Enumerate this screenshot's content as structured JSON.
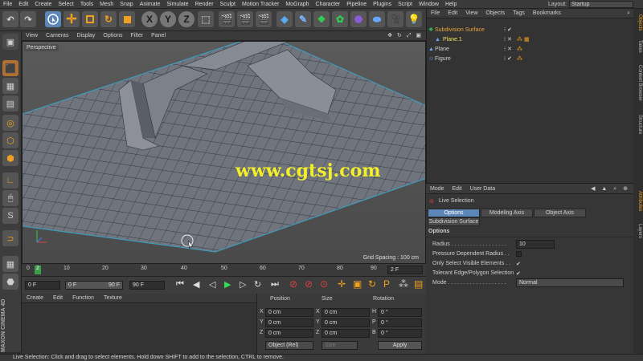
{
  "menubar": {
    "items": [
      "File",
      "Edit",
      "Create",
      "Select",
      "Tools",
      "Mesh",
      "Snap",
      "Animate",
      "Simulate",
      "Render",
      "Sculpt",
      "Motion Tracker",
      "MoGraph",
      "Character",
      "Pipeline",
      "Plugins",
      "Script",
      "Window",
      "Help"
    ],
    "layout_label": "Layout:",
    "layout_value": "Startup"
  },
  "toolbar": {
    "axis_x": "X",
    "axis_y": "Y",
    "axis_z": "Z"
  },
  "viewport": {
    "menu": [
      "View",
      "Cameras",
      "Display",
      "Options",
      "Filter",
      "Panel"
    ],
    "camera_label": "Perspective",
    "grid_spacing": "Grid Spacing : 100 cm",
    "watermark": "www.cgtsj.com"
  },
  "timeline": {
    "ticks": [
      "0",
      "10",
      "20",
      "30",
      "40",
      "50",
      "60",
      "70",
      "80",
      "90"
    ],
    "current_frame": "2",
    "end_frame_field": "2 F"
  },
  "transport": {
    "start_field": "0 F",
    "min_field": "0 F",
    "max_field": "90 F",
    "end_field": "90 F"
  },
  "material": {
    "menu": [
      "Create",
      "Edit",
      "Function",
      "Texture"
    ]
  },
  "coordinates": {
    "headers": [
      "Position",
      "Size",
      "Rotation"
    ],
    "rows": [
      {
        "axis": "X",
        "pos": "0 cm",
        "size_axis": "X",
        "size": "0 cm",
        "rot_axis": "H",
        "rot": "0 °"
      },
      {
        "axis": "Y",
        "pos": "0 cm",
        "size_axis": "Y",
        "size": "0 cm",
        "rot_axis": "P",
        "rot": "0 °"
      },
      {
        "axis": "Z",
        "pos": "0 cm",
        "size_axis": "Z",
        "size": "0 cm",
        "rot_axis": "B",
        "rot": "0 °"
      }
    ],
    "mode_select": "Object (Rel)",
    "size_select": "Size",
    "apply_label": "Apply"
  },
  "objects": {
    "menu": [
      "File",
      "Edit",
      "View",
      "Objects",
      "Tags",
      "Bookmarks"
    ],
    "items": [
      {
        "name": "Subdivision Surface",
        "color": "#e8a33a"
      },
      {
        "name": "Plane.1",
        "color": "#f0e060"
      },
      {
        "name": "Plane",
        "color": "#dcdcdc"
      },
      {
        "name": "Figure",
        "color": "#dcdcdc"
      }
    ]
  },
  "attributes": {
    "menu": [
      "Mode",
      "Edit",
      "User Data"
    ],
    "tool_name": "Live Selection",
    "tabs": [
      "Options",
      "Modeling Axis",
      "Object Axis"
    ],
    "tab2": "Subdivision Surface",
    "section": "Options",
    "radius_label": "Radius . . . . . . . . . . . . . . . . . .",
    "radius_value": "10",
    "pressure_label": "Pressure Dependent Radius . .",
    "visible_label": "Only Select Visible Elements . .",
    "visible_check": "✔",
    "tolerant_label": "Tolerant Edge/Polygon Selection",
    "tolerant_check": "✔",
    "mode_label": "Mode . . . . . . . . . . . . . . . . . . .",
    "mode_value": "Normal"
  },
  "right_tabs": [
    "Objects",
    "Takes",
    "Content Browser",
    "Structure",
    "Attributes",
    "Layers"
  ],
  "maxon": "MAXON CINEMA 4D",
  "status": "Live Selection: Click and drag to select elements. Hold down SHIFT to add to the selection, CTRL to remove.",
  "colors": {
    "accent": "#5c86b7",
    "selection": "#e8a33a",
    "watermark": "#f2ee2a"
  }
}
